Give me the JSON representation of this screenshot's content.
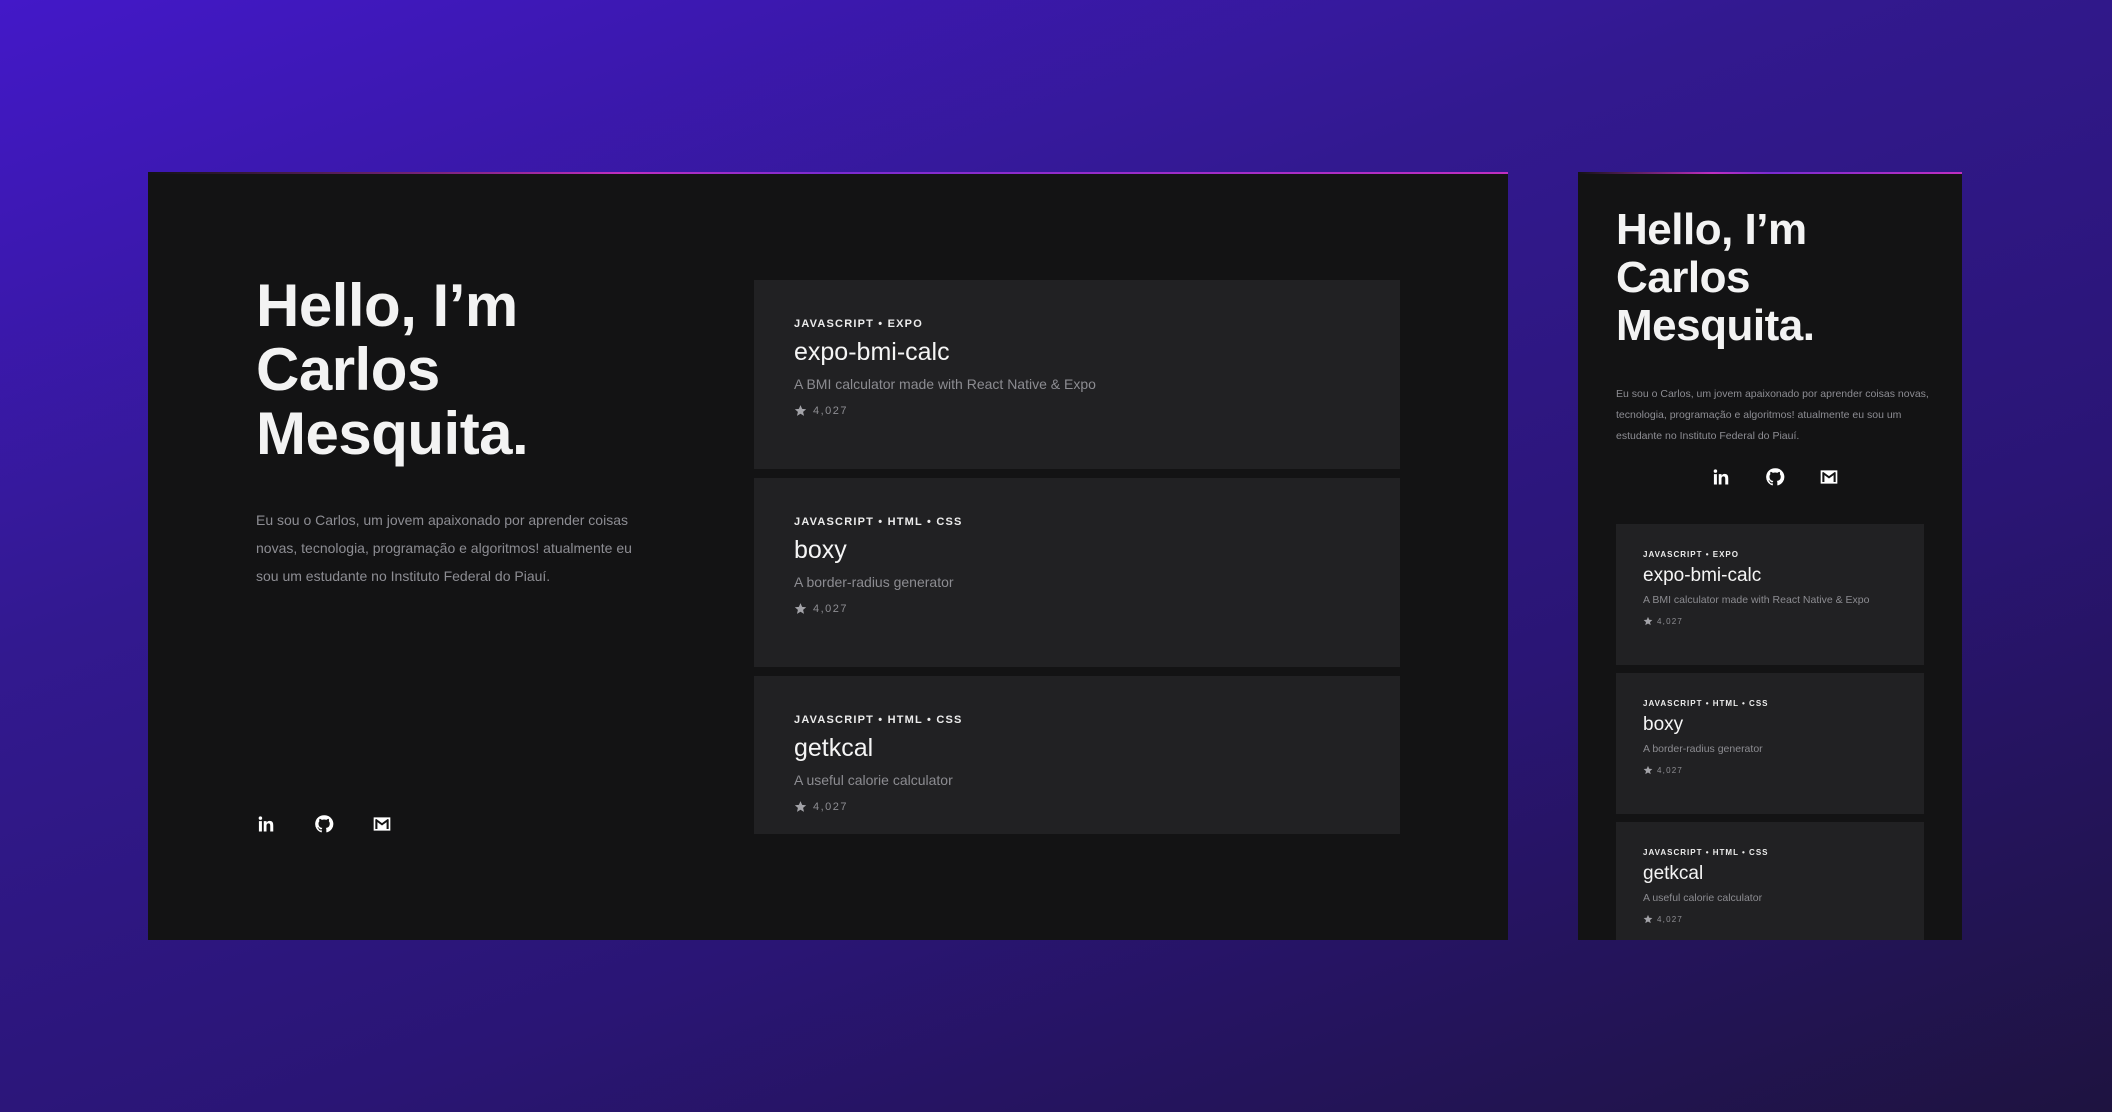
{
  "intro": {
    "greeting_lines": [
      "Hello, I’m",
      "Carlos",
      "Mesquita."
    ],
    "bio": "Eu sou o Carlos, um jovem apaixonado por aprender coisas novas, tecnologia, programação e algoritmos! atualmente eu sou um estudante no Instituto Federal do Piauí."
  },
  "socials": [
    {
      "icon": "linkedin-icon"
    },
    {
      "icon": "github-icon"
    },
    {
      "icon": "gmail-icon"
    }
  ],
  "projects": [
    {
      "tags": "JAVASCRIPT • EXPO",
      "name": "expo-bmi-calc",
      "description": "A BMI calculator made with React Native & Expo",
      "stars": "4,027"
    },
    {
      "tags": "JAVASCRIPT • HTML • CSS",
      "name": "boxy",
      "description": "A border-radius generator",
      "stars": "4,027"
    },
    {
      "tags": "JAVASCRIPT • HTML • CSS",
      "name": "getkcal",
      "description": "A useful calorie calculator",
      "stars": "4,027"
    }
  ],
  "colors": {
    "background_start": "#4318c8",
    "background_end": "#1e1340",
    "panel": "#131314",
    "card": "#212123",
    "accent_line": "#c02fc0"
  }
}
